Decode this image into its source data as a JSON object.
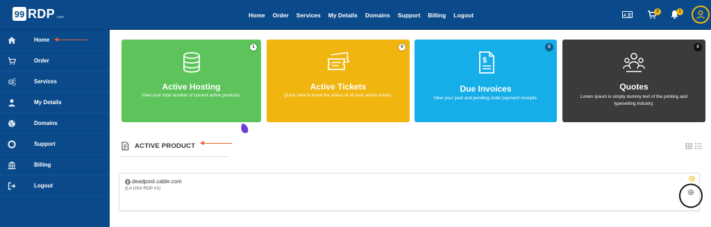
{
  "header": {
    "logo_number": "99",
    "logo_text": "RDP",
    "logo_sub": ".com",
    "nav": [
      "Home",
      "Order",
      "Services",
      "My Details",
      "Domains",
      "Support",
      "Billing",
      "Logout"
    ],
    "lang_label": "A 文",
    "cart_count": "0",
    "notification_count": "1",
    "accent_color": "#f2b90f",
    "bar_color": "#0b4a8a"
  },
  "sidebar": {
    "items": [
      {
        "label": "Home",
        "icon": "home-icon"
      },
      {
        "label": "Order",
        "icon": "cart-icon"
      },
      {
        "label": "Services",
        "icon": "gears-icon"
      },
      {
        "label": "My Details",
        "icon": "user-icon"
      },
      {
        "label": "Domains",
        "icon": "globe-icon"
      },
      {
        "label": "Support",
        "icon": "lifebuoy-icon"
      },
      {
        "label": "Billing",
        "icon": "bank-icon"
      },
      {
        "label": "Logout",
        "icon": "sign-out-icon"
      }
    ]
  },
  "cards": [
    {
      "title": "Active Hosting",
      "desc": "View your total number of current active products.",
      "count": "1",
      "color": "#5cc45a",
      "icon": "database-icon"
    },
    {
      "title": "Active Tickets",
      "desc": "Quick view to know the status of all your active tickets.",
      "count": "0",
      "color": "#f0b50f",
      "icon": "ticket-icon"
    },
    {
      "title": "Due Invoices",
      "desc": "View your past and pending order payment receipts.",
      "count": "0",
      "color": "#16aee8",
      "icon": "invoice-icon"
    },
    {
      "title": "Quotes",
      "desc": "Lorem Ipsum is simply dummy text of the printing and typesetting industry.",
      "count": "0",
      "color": "#3b3b3b",
      "icon": "team-icon"
    }
  ],
  "active_product": {
    "title": "ACTIVE PRODUCT",
    "host": "deadpool.cable.com",
    "plan": "(LA USA RDP #1)"
  }
}
